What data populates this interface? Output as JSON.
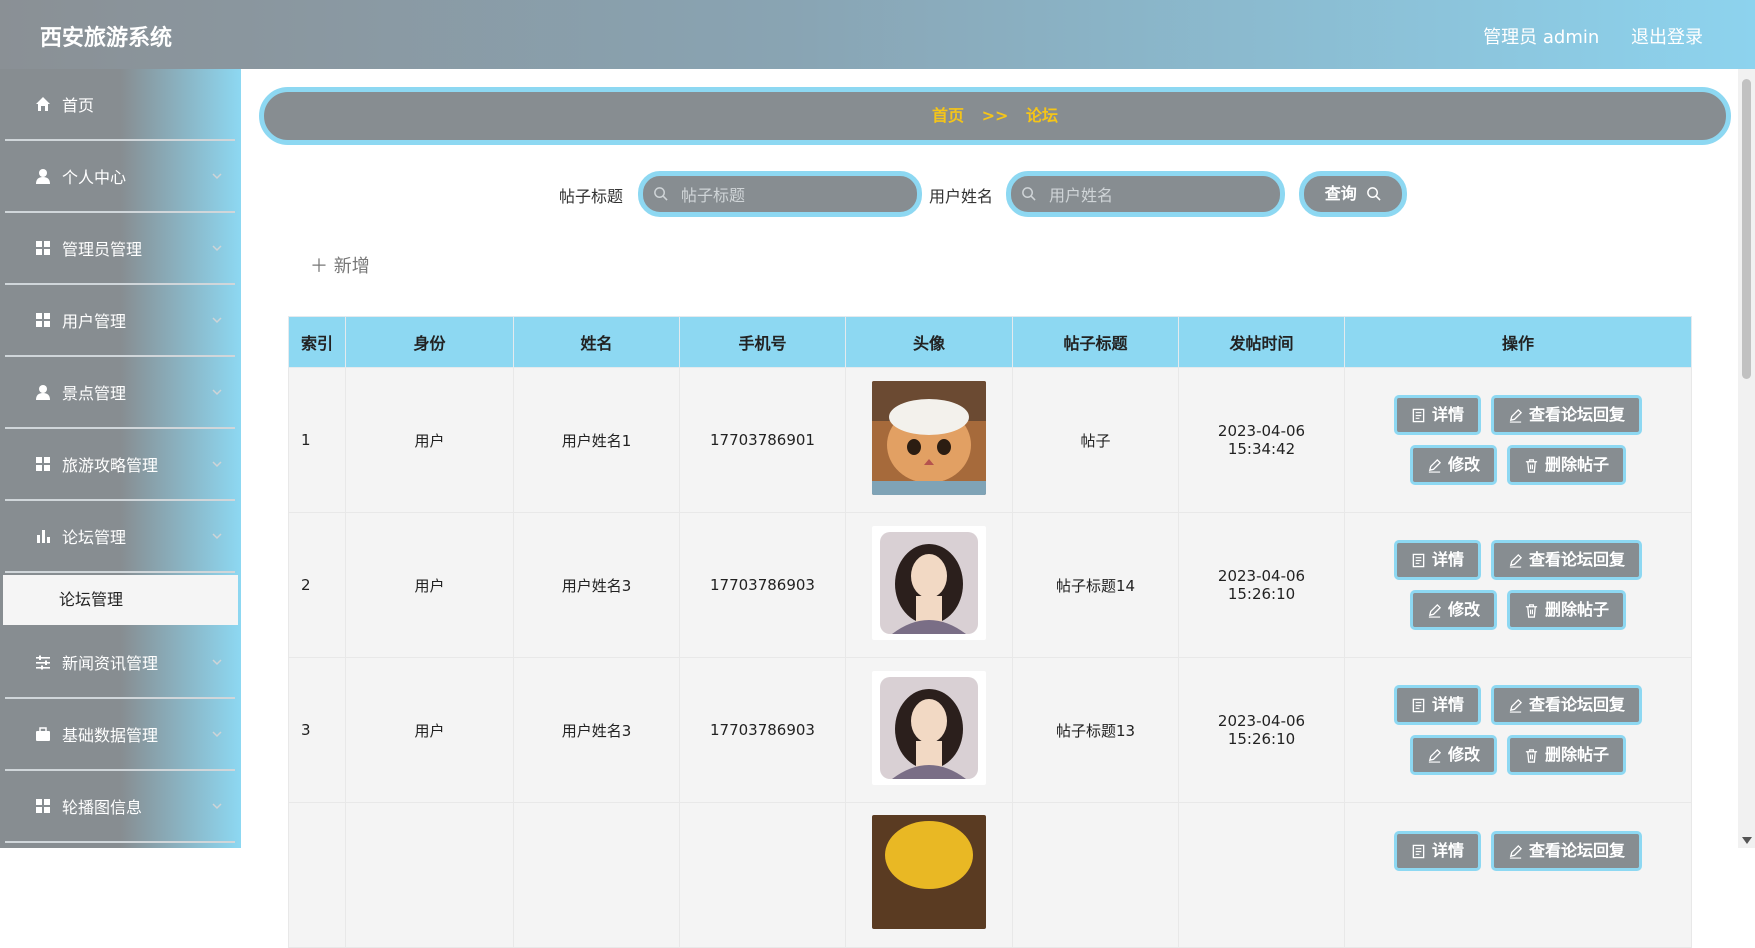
{
  "app": {
    "title": "西安旅游系统"
  },
  "header": {
    "user_label": "管理员 admin",
    "logout_label": "退出登录"
  },
  "sidebar": {
    "items": [
      {
        "label": "首页",
        "icon": "home-icon"
      },
      {
        "label": "个人中心",
        "icon": "user-icon"
      },
      {
        "label": "管理员管理",
        "icon": "grid-icon"
      },
      {
        "label": "用户管理",
        "icon": "grid-icon"
      },
      {
        "label": "景点管理",
        "icon": "user-icon"
      },
      {
        "label": "旅游攻略管理",
        "icon": "grid-icon"
      },
      {
        "label": "论坛管理",
        "icon": "bar-chart-icon"
      },
      {
        "label": "新闻资讯管理",
        "icon": "sliders-icon"
      },
      {
        "label": "基础数据管理",
        "icon": "briefcase-icon"
      },
      {
        "label": "轮播图信息",
        "icon": "grid-icon"
      }
    ],
    "submenu": {
      "label": "论坛管理"
    }
  },
  "breadcrumb": {
    "home": "首页",
    "separator": ">>",
    "current": "论坛"
  },
  "search": {
    "title_label": "帖子标题",
    "title_placeholder": "帖子标题",
    "name_label": "用户姓名",
    "name_placeholder": "用户姓名",
    "query_label": "查询"
  },
  "actions": {
    "add_label": "新增"
  },
  "table": {
    "headers": [
      "索引",
      "身份",
      "姓名",
      "手机号",
      "头像",
      "帖子标题",
      "发帖时间",
      "操作"
    ],
    "rows": [
      {
        "index": "1",
        "role": "用户",
        "name": "用户姓名1",
        "phone": "17703786901",
        "avatar": "cat",
        "title": "帖子",
        "time": "2023-04-06 15:34:42"
      },
      {
        "index": "2",
        "role": "用户",
        "name": "用户姓名3",
        "phone": "17703786903",
        "avatar": "woman",
        "title": "帖子标题14",
        "time": "2023-04-06 15:26:10"
      },
      {
        "index": "3",
        "role": "用户",
        "name": "用户姓名3",
        "phone": "17703786903",
        "avatar": "woman",
        "title": "帖子标题13",
        "time": "2023-04-06 15:26:10"
      },
      {
        "index": "",
        "role": "",
        "name": "",
        "phone": "",
        "avatar": "yellow",
        "title": "",
        "time": ""
      }
    ],
    "ops": {
      "detail": "详情",
      "view_replies": "查看论坛回复",
      "edit": "修改",
      "delete": "删除帖子"
    }
  },
  "colors": {
    "accent": "#8dd8f2",
    "gray": "#878d91",
    "breadcrumb_text": "#f5c518"
  }
}
